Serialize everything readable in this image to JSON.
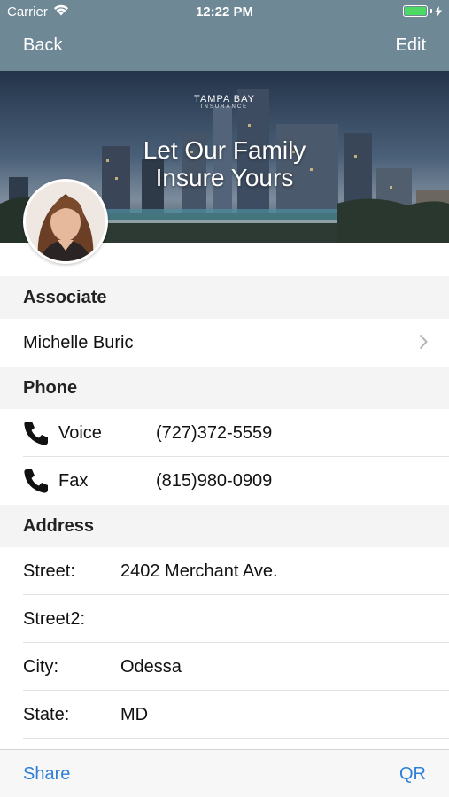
{
  "status": {
    "carrier": "Carrier",
    "time": "12:22 PM"
  },
  "nav": {
    "back": "Back",
    "edit": "Edit"
  },
  "banner": {
    "logo_text": "TAMPA BAY",
    "logo_sub": "INSURANCE",
    "tagline_line1": "Let Our Family",
    "tagline_line2": "Insure Yours"
  },
  "associate": {
    "header": "Associate",
    "name": "Michelle Buric"
  },
  "phone": {
    "header": "Phone",
    "entries": [
      {
        "label": "Voice",
        "value": "(727)372-5559"
      },
      {
        "label": "Fax",
        "value": "(815)980-0909"
      }
    ]
  },
  "address": {
    "header": "Address",
    "rows": [
      {
        "label": "Street:",
        "value": "2402 Merchant Ave."
      },
      {
        "label": "Street2:",
        "value": ""
      },
      {
        "label": "City:",
        "value": "Odessa"
      },
      {
        "label": "State:",
        "value": "MD"
      }
    ]
  },
  "toolbar": {
    "share": "Share",
    "qr": "QR"
  },
  "colors": {
    "nav_bar": "#6f8896",
    "accent": "#2e7fd6",
    "section_bg": "#f4f4f4",
    "battery": "#4cd964"
  },
  "icons": {
    "wifi": "wifi-icon",
    "battery": "battery-icon",
    "chevron": "chevron-right-icon",
    "phone": "phone-icon",
    "avatar": "avatar"
  }
}
